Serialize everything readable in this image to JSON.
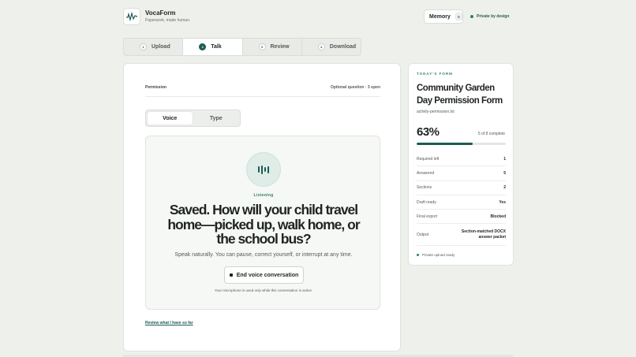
{
  "brand": {
    "name": "VocaForm",
    "tagline": "Paperwork, made human."
  },
  "memory": {
    "label": "Memory",
    "count": "0"
  },
  "privacy": {
    "label": "Private by design"
  },
  "steps": [
    {
      "num": "1",
      "label": "Upload"
    },
    {
      "num": "2",
      "label": "Talk"
    },
    {
      "num": "3",
      "label": "Review"
    },
    {
      "num": "4",
      "label": "Download"
    }
  ],
  "main": {
    "section_label": "Permission",
    "section_meta": "Optional question · 3 open",
    "modes": {
      "voice": "Voice",
      "type": "Type"
    },
    "status": "Listening",
    "question": "Saved. How will your child travel home—picked up, walk home, or the school bus?",
    "hint": "Speak naturally. You can pause, correct yourself, or interrupt at any time.",
    "end_button": "End voice conversation",
    "mic_note": "Your microphone is used only while this conversation is active.",
    "review_link": "Review what I have so far"
  },
  "sidebar": {
    "eyebrow": "TODAY'S FORM",
    "title": "Community Garden Day Permission Form",
    "file": "activity-permission.txt",
    "percent": "63%",
    "progress_fraction": 0.63,
    "complete_text": "5 of 8 complete",
    "stats": [
      {
        "key": "Required left",
        "value": "1"
      },
      {
        "key": "Answered",
        "value": "5"
      },
      {
        "key": "Sections",
        "value": "2"
      },
      {
        "key": "Draft ready",
        "value": "Yes"
      },
      {
        "key": "Final export",
        "value": "Blocked"
      },
      {
        "key": "Output",
        "value": "Section-matched DOCX answer packet"
      }
    ],
    "upload_status": "Private upload ready"
  },
  "colors": {
    "accent": "#1c5c52",
    "accent_light": "#2f7d6d",
    "background": "#eef0ec"
  }
}
